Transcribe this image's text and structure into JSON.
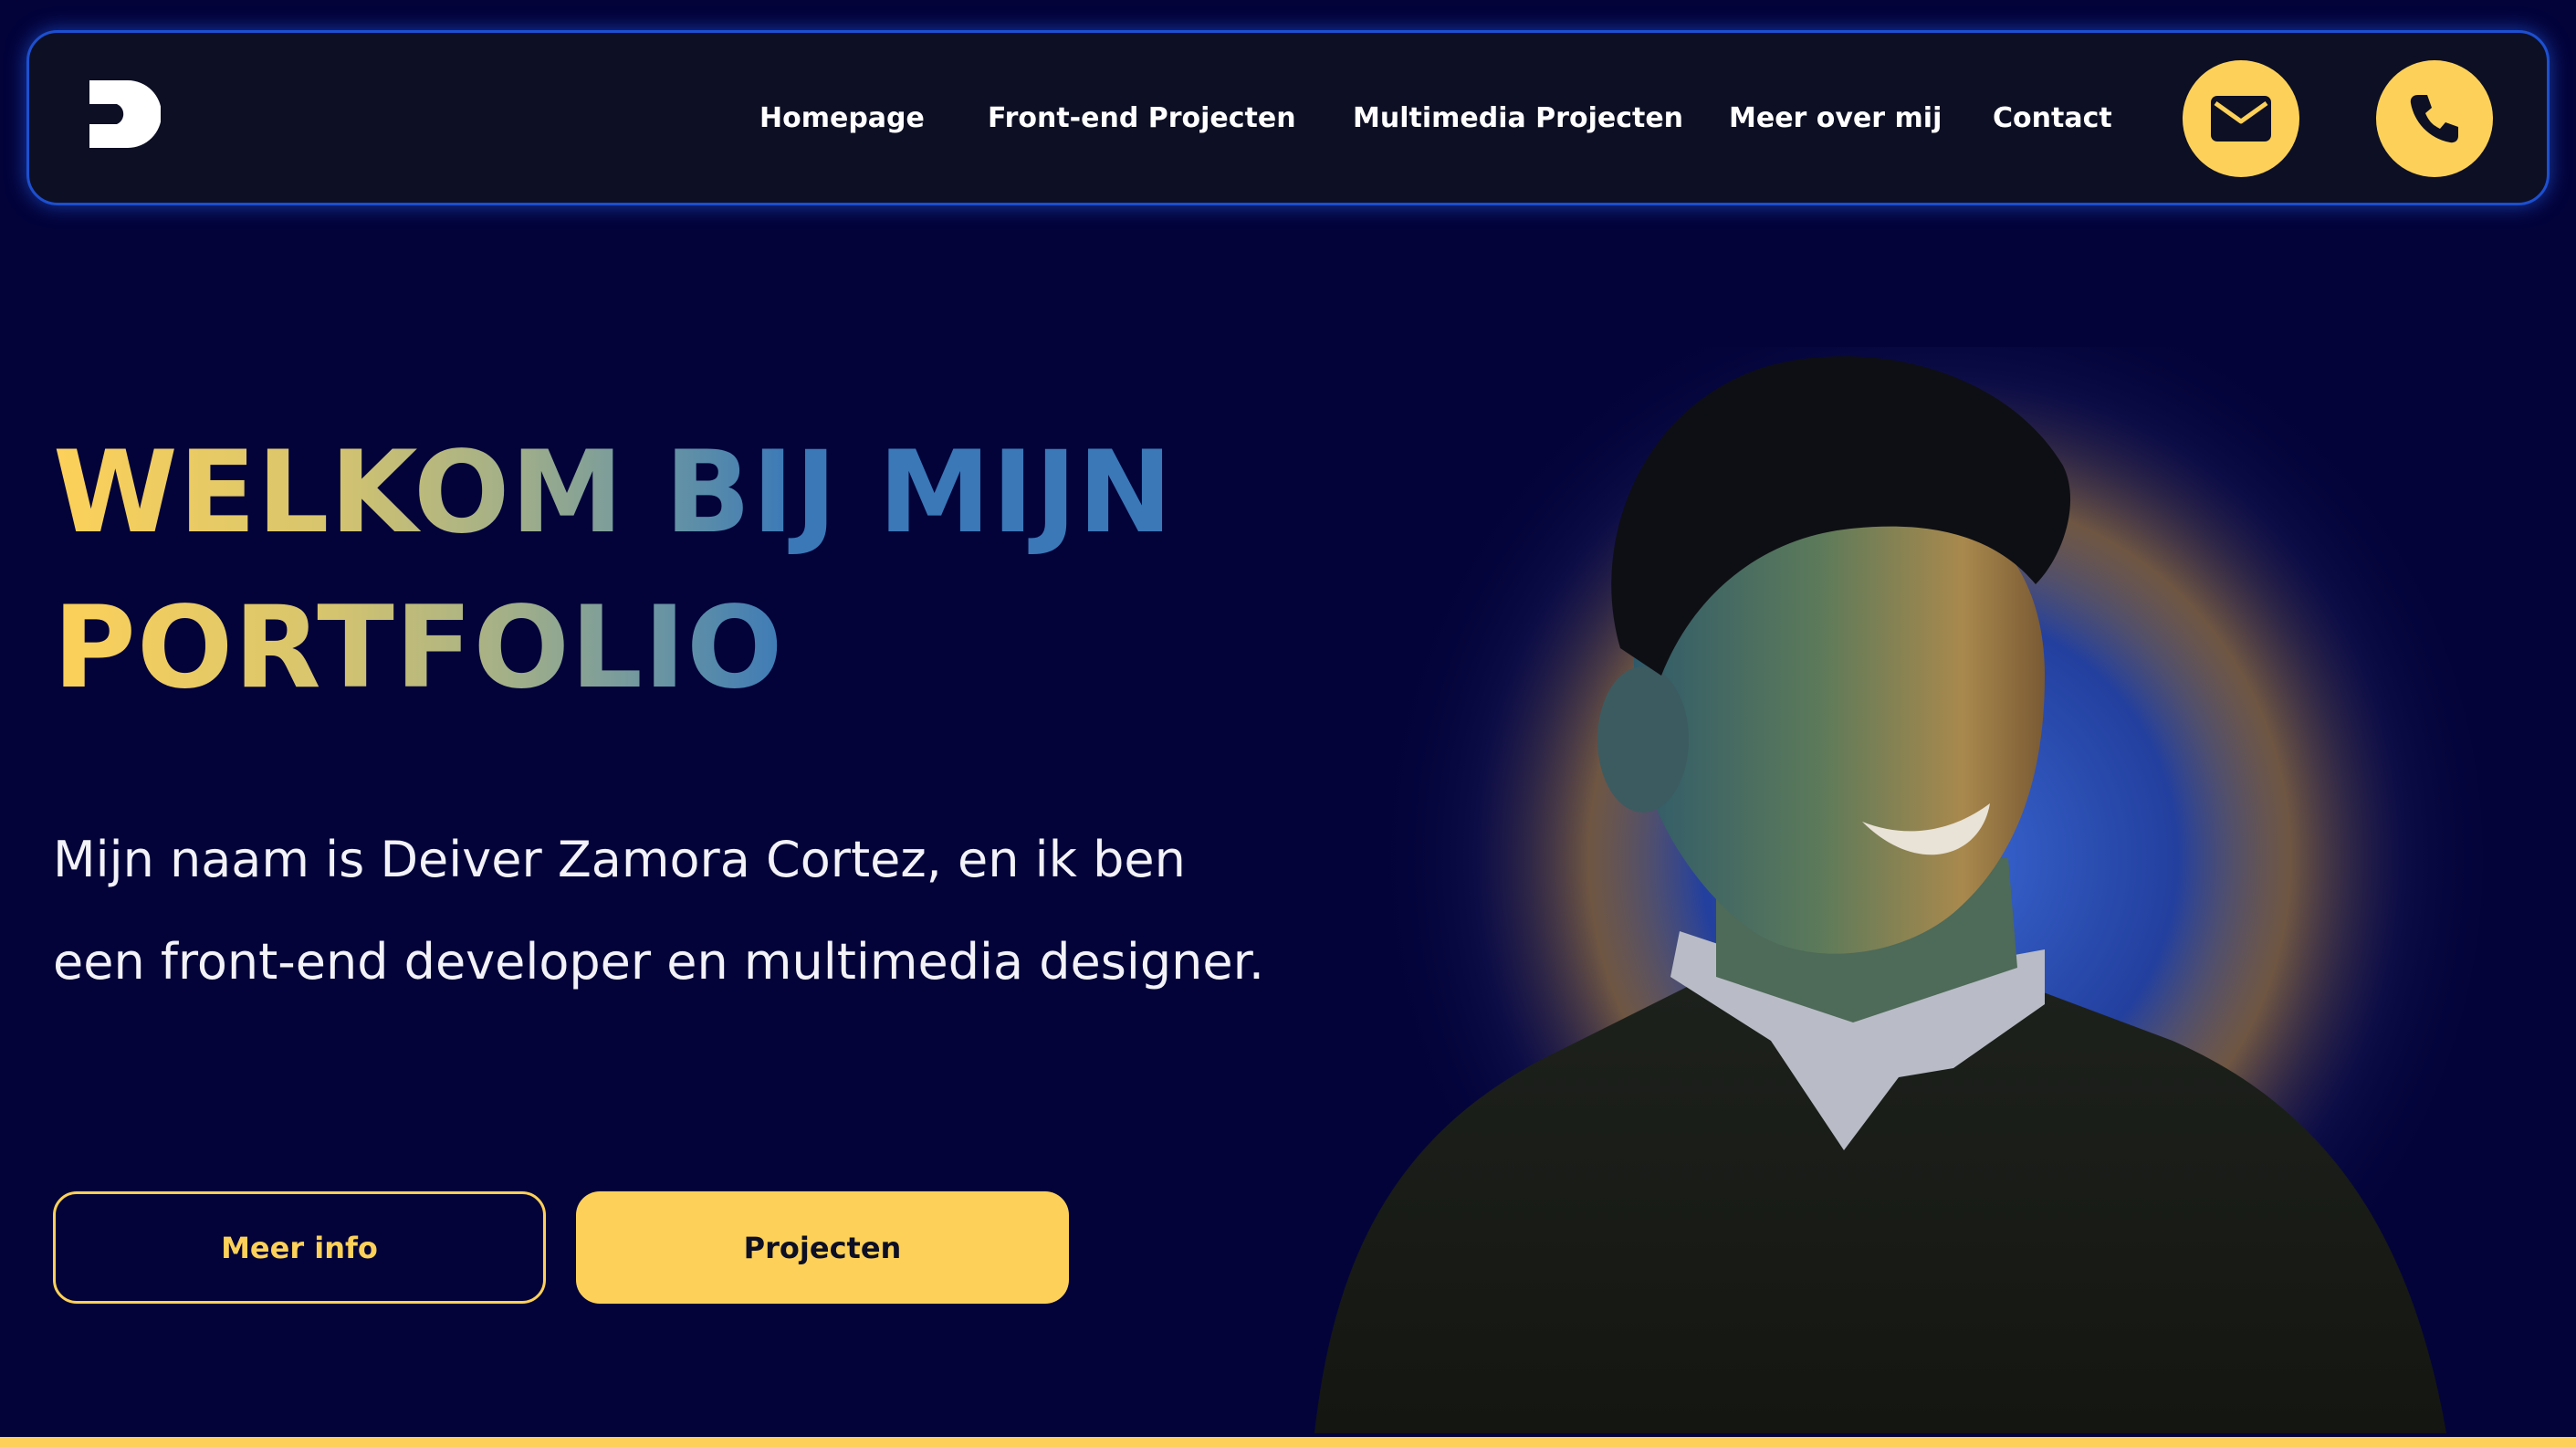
{
  "nav": {
    "logo_icon": "d-logo-icon",
    "links": [
      {
        "label": "Homepage"
      },
      {
        "label": "Front-end Projecten"
      },
      {
        "label": "Multimedia Projecten"
      },
      {
        "label": "Meer over mij"
      },
      {
        "label": "Contact"
      }
    ],
    "icon_buttons": [
      {
        "icon": "envelope-icon"
      },
      {
        "icon": "phone-icon"
      }
    ]
  },
  "hero": {
    "title_line1": "WELKOM BIJ MIJN",
    "title_line2": "PORTFOLIO",
    "intro": "Mijn naam is Deiver Zamora Cortez, en ik ben een front-end developer en multimedia designer.",
    "buttons": {
      "more_info": "Meer info",
      "projects": "Projecten"
    }
  },
  "colors": {
    "background": "#03033a",
    "navbar": "#0d0f24",
    "navbar_border": "#1d4fd0",
    "accent_yellow": "#fdd159",
    "gradient_blue": "#3a78b8",
    "text": "#ffffff"
  }
}
